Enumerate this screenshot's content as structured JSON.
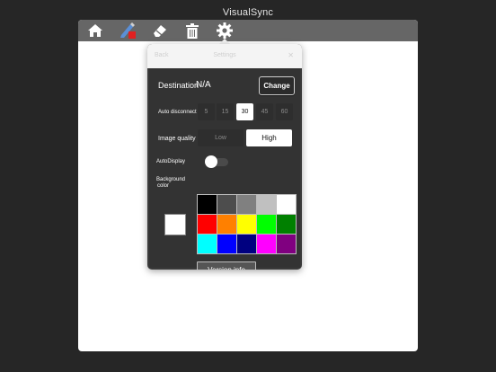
{
  "app": {
    "title": "VisualSync"
  },
  "toolbar": {
    "icons": [
      "home-icon",
      "pen-icon",
      "eraser-icon",
      "trash-icon",
      "gear-icon"
    ]
  },
  "settings": {
    "header": {
      "back_label": "Back",
      "title_label": "Settings",
      "close_label": "✕"
    },
    "destination": {
      "label": "Destination",
      "value": "N/A",
      "change_label": "Change"
    },
    "auto_disconnect": {
      "label": "Auto disconnect",
      "options": [
        "5",
        "15",
        "30",
        "45",
        "60"
      ],
      "selected": "30"
    },
    "image_quality": {
      "label": "Image quality",
      "options": [
        "Low",
        "High"
      ],
      "selected": "High"
    },
    "auto_display": {
      "label": "AutoDisplay",
      "on": false
    },
    "background_color": {
      "label_line1": "Background",
      "label_line2": "color",
      "current": "#ffffff",
      "palette": [
        "#000000",
        "#4d4d4d",
        "#808080",
        "#c0c0c0",
        "#ffffff",
        "#ff0000",
        "#ff8000",
        "#ffff00",
        "#00ff00",
        "#008000",
        "#00ffff",
        "#0000ff",
        "#000080",
        "#ff00ff",
        "#800080"
      ]
    },
    "version_label": "Version info"
  }
}
